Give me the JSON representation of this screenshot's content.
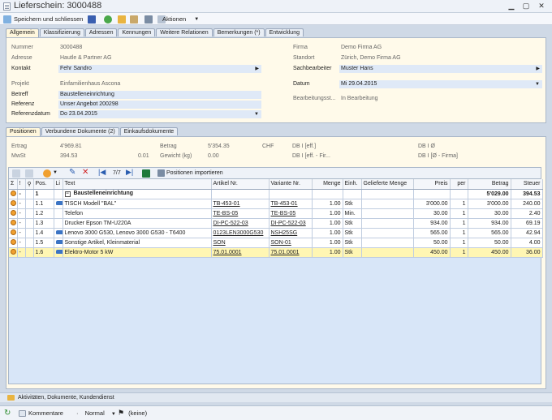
{
  "window": {
    "title": "Lieferschein: 3000488"
  },
  "toolbar": {
    "save_close": "Speichern und schliessen",
    "actions": "Aktionen"
  },
  "top_tabs": [
    "Allgemein",
    "Klassifizierung",
    "Adressen",
    "Kennungen",
    "Weitere Relationen",
    "Bemerkungen (*)",
    "Entwicklung"
  ],
  "general": {
    "nummer_label": "Nummer",
    "nummer": "3000488",
    "adresse_label": "Adresse",
    "adresse": "Hautle & Partner AG",
    "kontakt_label": "Kontakt",
    "kontakt": "Fehr Sandro",
    "projekt_label": "Projekt",
    "projekt": "Einfamilienhaus Ascona",
    "betreff_label": "Betreff",
    "betreff": "Baustelleneinrichtung",
    "referenz_label": "Referenz",
    "referenz": "Unser Angebot 200298",
    "referenzdatum_label": "Referenzdatum",
    "referenzdatum": "Do 23.04.2015",
    "firma_label": "Firma",
    "firma": "Demo Firma AG",
    "standort_label": "Standort",
    "standort": "Zürich, Demo Firma AG",
    "sachbearbeiter_label": "Sachbearbeiter",
    "sachbearbeiter": "Muster Hans",
    "datum_label": "Datum",
    "datum": "Mi 29.04.2015",
    "bearbeitung_label": "Bearbeitungsst...",
    "bearbeitung": "In Bearbeitung"
  },
  "sub_tabs": [
    "Positionen",
    "Verbundene Dokumente (2)",
    "Einkaufsdokumente"
  ],
  "summary": {
    "ertrag_label": "Ertrag",
    "ertrag": "4'969.81",
    "mwst_label": "MwSt",
    "mwst": "394.53",
    "mwst_rate": "0.01",
    "betrag_label": "Betrag",
    "betrag": "5'354.35",
    "currency": "CHF",
    "gewicht_label": "Gewicht (kg)",
    "gewicht": "0.00",
    "db1_eff": "DB I [eff.]",
    "db1_eff_firma": "DB I [eff. - Fir...",
    "db1_pct": "DB I Ø",
    "db1_pct_firma": "DB I [Ø - Firma]"
  },
  "grid_toolbar": {
    "page": "7/7",
    "import": "Positionen importieren"
  },
  "columns": [
    "Pos.",
    "Li",
    "Text",
    "Artikel Nr.",
    "Variante Nr.",
    "Menge",
    "Einh.",
    "Gelieferte Menge",
    "Preis",
    "per",
    "Betrag",
    "Steuer"
  ],
  "rows": [
    {
      "pos": "1",
      "text": "Baustelleneinrichtung",
      "artikel": "",
      "variante": "",
      "menge": "",
      "einh": "",
      "preis": "",
      "per": "",
      "betrag": "5'029.00",
      "steuer": "394.53",
      "group": true,
      "car": false
    },
    {
      "pos": "1.1",
      "text": "TISCH Modell \"BAL\"",
      "artikel": "TB-453-01",
      "variante": "TB-453-01",
      "menge": "1.00",
      "einh": "Stk",
      "preis": "3'000.00",
      "per": "1",
      "betrag": "3'000.00",
      "steuer": "240.00",
      "group": false,
      "car": true
    },
    {
      "pos": "1.2",
      "text": "Telefon",
      "artikel": "TE-BS-05",
      "variante": "TE-BS-05",
      "menge": "1.00",
      "einh": "Min.",
      "preis": "30.00",
      "per": "1",
      "betrag": "30.00",
      "steuer": "2.40",
      "group": false,
      "car": false
    },
    {
      "pos": "1.3",
      "text": "Drucker Epson TM-U220A",
      "artikel": "DI-PC-522-03",
      "variante": "DI-PC-522-03",
      "menge": "1.00",
      "einh": "Stk",
      "preis": "934.00",
      "per": "1",
      "betrag": "934.00",
      "steuer": "69.19",
      "group": false,
      "car": false
    },
    {
      "pos": "1.4",
      "text": "Lenovo 3000 G530, Lenovo 3000 G530 - T6400",
      "artikel": "0123LEN3000G530",
      "variante": "NSH25SG",
      "menge": "1.00",
      "einh": "Stk",
      "preis": "565.00",
      "per": "1",
      "betrag": "565.00",
      "steuer": "42.94",
      "group": false,
      "car": true
    },
    {
      "pos": "1.5",
      "text": "Sonstige Artikel, Kleinmaterial",
      "artikel": "SON",
      "variante": "SON-01",
      "menge": "1.00",
      "einh": "Stk",
      "preis": "50.00",
      "per": "1",
      "betrag": "50.00",
      "steuer": "4.00",
      "group": false,
      "car": true
    },
    {
      "pos": "1.6",
      "text": "Elektro-Motor 5 kW",
      "artikel": "75.01.0001",
      "variante": "75.01.0001",
      "menge": "1.00",
      "einh": "Stk",
      "preis": "450.00",
      "per": "1",
      "betrag": "450.00",
      "steuer": "36.00",
      "group": false,
      "car": true,
      "selected": true
    }
  ],
  "bottom": {
    "activities": "Aktivitäten, Dokumente, Kundendienst"
  },
  "status": {
    "comments": "Kommentare",
    "priority": "Normal",
    "flag": "(keine)"
  }
}
